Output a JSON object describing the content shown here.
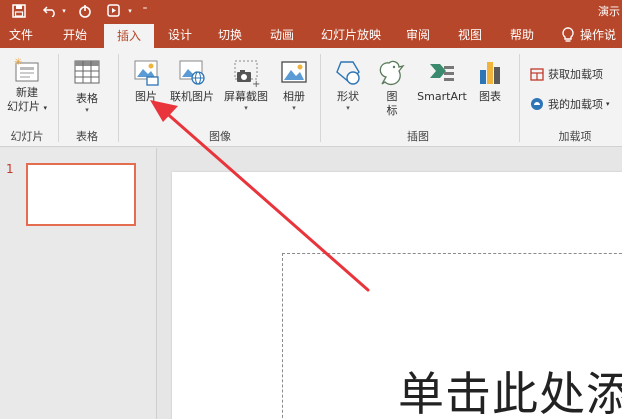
{
  "titlebar": {
    "title": "演示"
  },
  "tabs": [
    {
      "label": "文件",
      "active": false
    },
    {
      "label": "开始",
      "active": false
    },
    {
      "label": "插入",
      "active": true
    },
    {
      "label": "设计",
      "active": false
    },
    {
      "label": "切换",
      "active": false
    },
    {
      "label": "动画",
      "active": false
    },
    {
      "label": "幻灯片放映",
      "active": false
    },
    {
      "label": "审阅",
      "active": false
    },
    {
      "label": "视图",
      "active": false
    },
    {
      "label": "帮助",
      "active": false
    },
    {
      "label": "操作说",
      "active": false
    }
  ],
  "ribbon": {
    "slides_group": {
      "label": "幻灯片",
      "new_slide_line1": "新建",
      "new_slide_line2": "幻灯片"
    },
    "tables_group": {
      "label": "表格",
      "table_button": "表格"
    },
    "images_group": {
      "label": "图像",
      "picture": "图片",
      "online_picture": "联机图片",
      "screenshot": "屏幕截图",
      "album": "相册"
    },
    "illustrations_group": {
      "label": "插图",
      "shapes": "形状",
      "icons_line1": "图",
      "icons_line2": "标",
      "smartart": "SmartArt",
      "chart": "图表"
    },
    "addins_group": {
      "label": "加载项",
      "get_addins": "获取加载项",
      "my_addins": "我的加载项"
    }
  },
  "thumbnails": {
    "slide_number": "1"
  },
  "slide": {
    "placeholder_text": "单击此处添"
  },
  "colors": {
    "accent": "#b7472a",
    "thumb_border": "#e46c4f",
    "annotation_arrow": "#e8343a"
  }
}
